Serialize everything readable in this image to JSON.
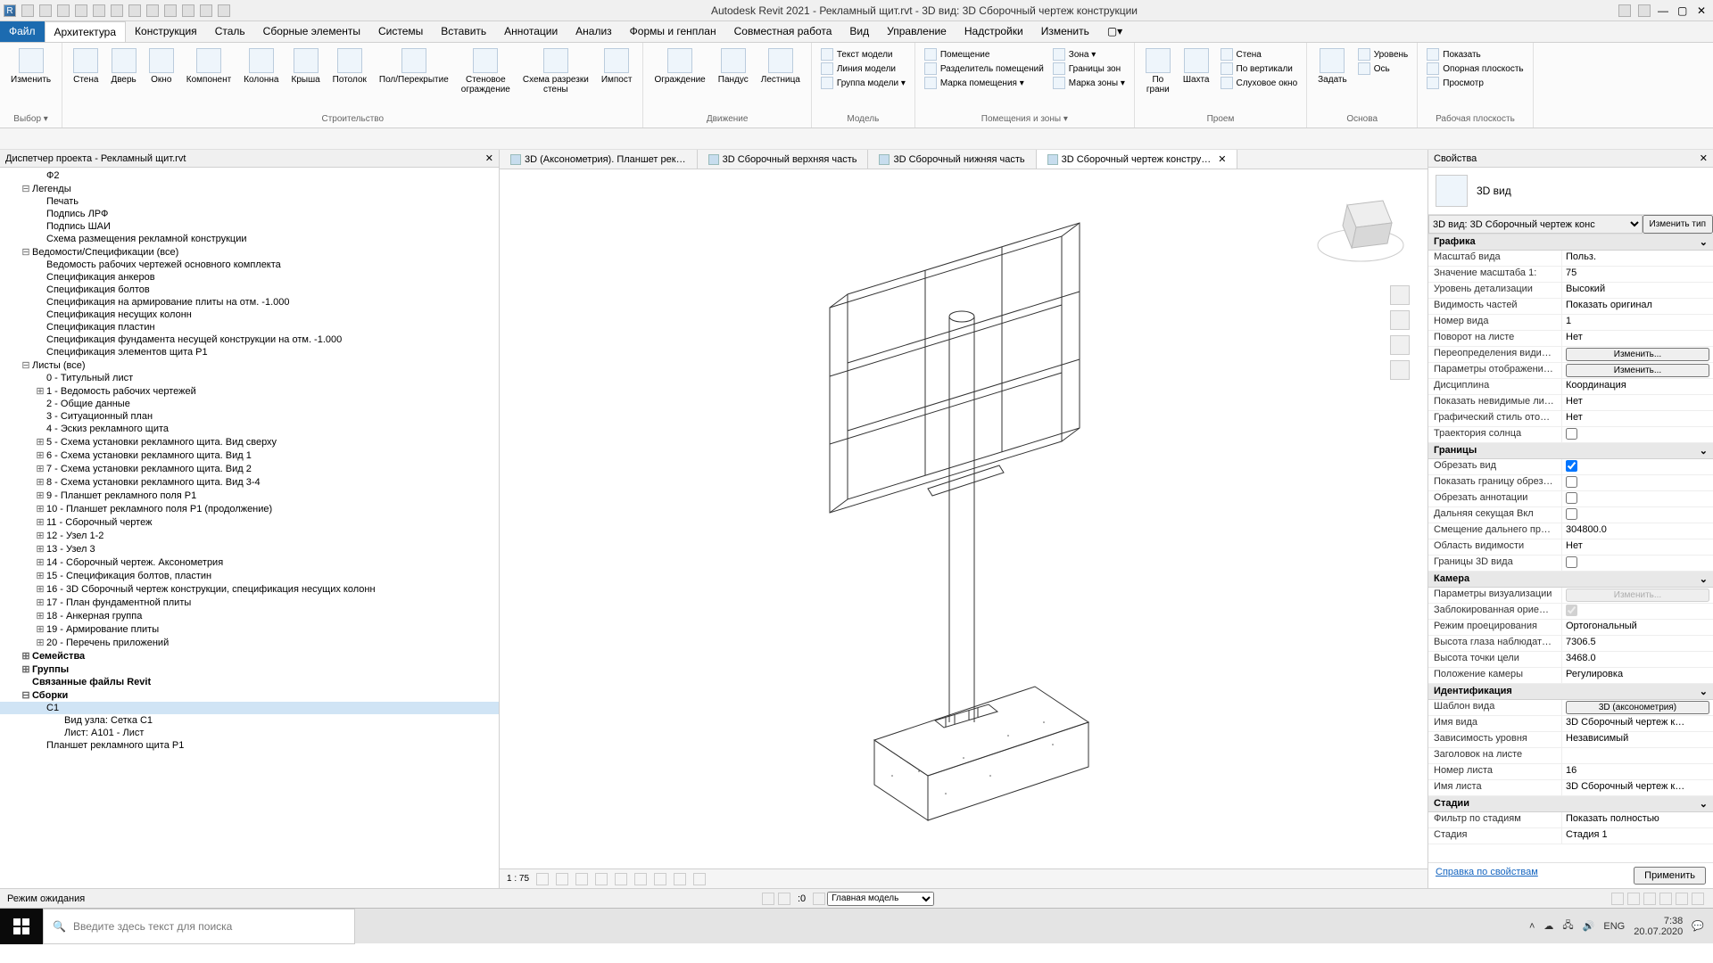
{
  "title": "Autodesk Revit 2021 - Рекламный щит.rvt - 3D вид: 3D Сборочный чертеж конструкции",
  "tabs": {
    "file": "Файл",
    "items": [
      "Архитектура",
      "Конструкция",
      "Сталь",
      "Сборные элементы",
      "Системы",
      "Вставить",
      "Аннотации",
      "Анализ",
      "Формы и генплан",
      "Совместная работа",
      "Вид",
      "Управление",
      "Надстройки",
      "Изменить"
    ]
  },
  "ribbon": {
    "groups": [
      {
        "label": "Выбор ▾",
        "buttons": [
          {
            "name": "modify",
            "label": "Изменить"
          }
        ]
      },
      {
        "label": "Строительство",
        "buttons": [
          {
            "name": "wall",
            "label": "Стена"
          },
          {
            "name": "door",
            "label": "Дверь"
          },
          {
            "name": "window",
            "label": "Окно"
          },
          {
            "name": "component",
            "label": "Компонент"
          },
          {
            "name": "column",
            "label": "Колонна"
          },
          {
            "name": "roof",
            "label": "Крыша"
          },
          {
            "name": "ceiling",
            "label": "Потолок"
          },
          {
            "name": "floor",
            "label": "Пол/Перекрытие"
          },
          {
            "name": "curtain",
            "label": "Стеновое\nограждение"
          },
          {
            "name": "cgrid",
            "label": "Схема разрезки\nстены"
          },
          {
            "name": "mullion",
            "label": "Импост"
          }
        ]
      },
      {
        "label": "Движение",
        "buttons": [
          {
            "name": "railing",
            "label": "Ограждение"
          },
          {
            "name": "ramp",
            "label": "Пандус"
          },
          {
            "name": "stair",
            "label": "Лестница"
          }
        ]
      },
      {
        "label": "Модель",
        "small": [
          {
            "name": "mtext",
            "label": "Текст модели"
          },
          {
            "name": "mline",
            "label": "Линия модели"
          },
          {
            "name": "mgroup",
            "label": "Группа модели ▾"
          }
        ]
      },
      {
        "label": "Помещения и зоны ▾",
        "small": [
          {
            "name": "room",
            "label": "Помещение"
          },
          {
            "name": "rsep",
            "label": "Разделитель помещений"
          },
          {
            "name": "rtag",
            "label": "Марка помещения ▾"
          }
        ],
        "small2": [
          {
            "name": "zone",
            "label": "Зона ▾"
          },
          {
            "name": "zbound",
            "label": "Границы зон"
          },
          {
            "name": "ztag",
            "label": "Марка зоны ▾"
          }
        ]
      },
      {
        "label": "Проем",
        "buttons": [
          {
            "name": "face",
            "label": "По\nграни"
          },
          {
            "name": "shaft",
            "label": "Шахта"
          }
        ],
        "small": [
          {
            "name": "owall",
            "label": "Стена"
          },
          {
            "name": "overt",
            "label": "По вертикали"
          },
          {
            "name": "odorm",
            "label": "Слуховое окно"
          }
        ]
      },
      {
        "label": "Основа",
        "small": [
          {
            "name": "level",
            "label": "Уровень"
          },
          {
            "name": "axis",
            "label": "Ось"
          }
        ],
        "buttons": [
          {
            "name": "set",
            "label": "Задать"
          }
        ]
      },
      {
        "label": "Рабочая плоскость",
        "small": [
          {
            "name": "show",
            "label": "Показать"
          },
          {
            "name": "refp",
            "label": "Опорная плоскость"
          },
          {
            "name": "view",
            "label": "Просмотр"
          }
        ]
      }
    ]
  },
  "project_browser": {
    "title": "Диспетчер проекта - Рекламный щит.rvt",
    "items": [
      {
        "t": "Ф2",
        "lvl": 2
      },
      {
        "t": "Легенды",
        "lvl": 1,
        "exp": "-"
      },
      {
        "t": "Печать",
        "lvl": 2
      },
      {
        "t": "Подпись ЛРФ",
        "lvl": 2
      },
      {
        "t": "Подпись ШАИ",
        "lvl": 2
      },
      {
        "t": "Схема размещения рекламной конструкции",
        "lvl": 2
      },
      {
        "t": "Ведомости/Спецификации (все)",
        "lvl": 1,
        "exp": "-"
      },
      {
        "t": "Ведомость рабочих чертежей основного комплекта",
        "lvl": 2
      },
      {
        "t": "Спецификация анкеров",
        "lvl": 2
      },
      {
        "t": "Спецификация болтов",
        "lvl": 2
      },
      {
        "t": "Спецификация на армирование плиты на отм. -1.000",
        "lvl": 2
      },
      {
        "t": "Спецификация несущих колонн",
        "lvl": 2
      },
      {
        "t": "Спецификация пластин",
        "lvl": 2
      },
      {
        "t": "Спецификация фундамента несущей конструкции на отм. -1.000",
        "lvl": 2
      },
      {
        "t": "Спецификация элементов щита Р1",
        "lvl": 2
      },
      {
        "t": "Листы (все)",
        "lvl": 1,
        "exp": "-"
      },
      {
        "t": "0 - Титульный лист",
        "lvl": 2
      },
      {
        "t": "1 - Ведомость рабочих чертежей",
        "lvl": 2,
        "exp": "+"
      },
      {
        "t": "2 - Общие данные",
        "lvl": 2
      },
      {
        "t": "3 - Ситуационный план",
        "lvl": 2
      },
      {
        "t": "4 - Эскиз рекламного щита",
        "lvl": 2
      },
      {
        "t": "5 - Схема установки рекламного щита. Вид сверху",
        "lvl": 2,
        "exp": "+"
      },
      {
        "t": "6 - Схема установки рекламного щита. Вид 1",
        "lvl": 2,
        "exp": "+"
      },
      {
        "t": "7 - Схема установки рекламного щита. Вид 2",
        "lvl": 2,
        "exp": "+"
      },
      {
        "t": "8 - Схема установки рекламного щита. Вид 3-4",
        "lvl": 2,
        "exp": "+"
      },
      {
        "t": "9 - Планшет рекламного поля Р1",
        "lvl": 2,
        "exp": "+"
      },
      {
        "t": "10 - Планшет рекламного поля Р1 (продолжение)",
        "lvl": 2,
        "exp": "+"
      },
      {
        "t": "11 - Сборочный чертеж",
        "lvl": 2,
        "exp": "+"
      },
      {
        "t": "12 - Узел 1-2",
        "lvl": 2,
        "exp": "+"
      },
      {
        "t": "13 - Узел 3",
        "lvl": 2,
        "exp": "+"
      },
      {
        "t": "14 - Сборочный чертеж. Аксонометрия",
        "lvl": 2,
        "exp": "+"
      },
      {
        "t": "15 - Спецификация болтов, пластин",
        "lvl": 2,
        "exp": "+"
      },
      {
        "t": "16 - 3D Сборочный чертеж конструкции, спецификация несущих колонн",
        "lvl": 2,
        "exp": "+"
      },
      {
        "t": "17 - План фундаментной плиты",
        "lvl": 2,
        "exp": "+"
      },
      {
        "t": "18 - Анкерная группа",
        "lvl": 2,
        "exp": "+"
      },
      {
        "t": "19 - Армирование плиты",
        "lvl": 2,
        "exp": "+"
      },
      {
        "t": "20 - Перечень приложений",
        "lvl": 2,
        "exp": "+"
      },
      {
        "t": "Семейства",
        "lvl": 1,
        "exp": "+",
        "bold": true
      },
      {
        "t": "Группы",
        "lvl": 1,
        "exp": "+",
        "bold": true
      },
      {
        "t": "Связанные файлы Revit",
        "lvl": 1,
        "bold": true
      },
      {
        "t": "Сборки",
        "lvl": 1,
        "exp": "-",
        "bold": true
      },
      {
        "t": "C1",
        "lvl": 2,
        "sel": true
      },
      {
        "t": "Вид узла: Сетка С1",
        "lvl": 3
      },
      {
        "t": "Лист: А101 - Лист",
        "lvl": 3
      },
      {
        "t": "Планшет рекламного щита Р1",
        "lvl": 2
      }
    ]
  },
  "view_tabs": [
    {
      "label": "3D (Аксонометрия). Планшет рек…"
    },
    {
      "label": "3D Сборочный верхняя часть"
    },
    {
      "label": "3D Сборочный нижняя часть"
    },
    {
      "label": "3D Сборочный чертеж констру…",
      "active": true
    }
  ],
  "canvas_scale": "1 : 75",
  "props": {
    "title": "Свойства",
    "type": "3D вид",
    "selector": "3D вид: 3D Сборочный чертеж конс",
    "edit_type": "Изменить тип",
    "groups": [
      {
        "h": "Графика",
        "rows": [
          {
            "k": "Масштаб вида",
            "v": "Польз."
          },
          {
            "k": "Значение масштаба    1:",
            "v": "75"
          },
          {
            "k": "Уровень детализации",
            "v": "Высокий"
          },
          {
            "k": "Видимость частей",
            "v": "Показать оригинал"
          },
          {
            "k": "Номер вида",
            "v": "1"
          },
          {
            "k": "Поворот на листе",
            "v": "Нет"
          },
          {
            "k": "Переопределения види…",
            "btn": "Изменить..."
          },
          {
            "k": "Параметры отображени…",
            "btn": "Изменить..."
          },
          {
            "k": "Дисциплина",
            "v": "Координация"
          },
          {
            "k": "Показать невидимые ли…",
            "v": "Нет"
          },
          {
            "k": "Графический стиль ото…",
            "v": "Нет"
          },
          {
            "k": "Траектория солнца",
            "cb": false
          }
        ]
      },
      {
        "h": "Границы",
        "rows": [
          {
            "k": "Обрезать вид",
            "cb": true
          },
          {
            "k": "Показать границу обрез…",
            "cb": false
          },
          {
            "k": "Обрезать аннотации",
            "cb": false
          },
          {
            "k": "Дальняя секущая Вкл",
            "cb": false
          },
          {
            "k": "Смещение дальнего пр…",
            "v": "304800.0"
          },
          {
            "k": "Область видимости",
            "v": "Нет"
          },
          {
            "k": "Границы 3D вида",
            "cb": false
          }
        ]
      },
      {
        "h": "Камера",
        "rows": [
          {
            "k": "Параметры визуализации",
            "btn": "Изменить...",
            "dis": true
          },
          {
            "k": "Заблокированная орие…",
            "cb": true,
            "dis": true
          },
          {
            "k": "Режим проецирования",
            "v": "Ортогональный"
          },
          {
            "k": "Высота глаза наблюдат…",
            "v": "7306.5"
          },
          {
            "k": "Высота точки цели",
            "v": "3468.0"
          },
          {
            "k": "Положение камеры",
            "v": "Регулировка"
          }
        ]
      },
      {
        "h": "Идентификация",
        "rows": [
          {
            "k": "Шаблон вида",
            "btn": "3D (аксонометрия)"
          },
          {
            "k": "Имя вида",
            "v": "3D Сборочный чертеж к…"
          },
          {
            "k": "Зависимость уровня",
            "v": "Независимый"
          },
          {
            "k": "Заголовок на листе",
            "v": ""
          },
          {
            "k": "Номер листа",
            "v": "16"
          },
          {
            "k": "Имя листа",
            "v": "3D Сборочный чертеж к…"
          }
        ]
      },
      {
        "h": "Стадии",
        "rows": [
          {
            "k": "Фильтр по стадиям",
            "v": "Показать полностью"
          },
          {
            "k": "Стадия",
            "v": "Стадия 1"
          }
        ]
      }
    ],
    "help": "Справка по свойствам",
    "apply": "Применить"
  },
  "status": {
    "left": "Режим ожидания",
    "model": "Главная модель",
    "zero": ":0"
  },
  "taskbar": {
    "search": "Введите здесь текст для поиска",
    "lang": "ENG",
    "time": "7:38",
    "date": "20.07.2020"
  }
}
